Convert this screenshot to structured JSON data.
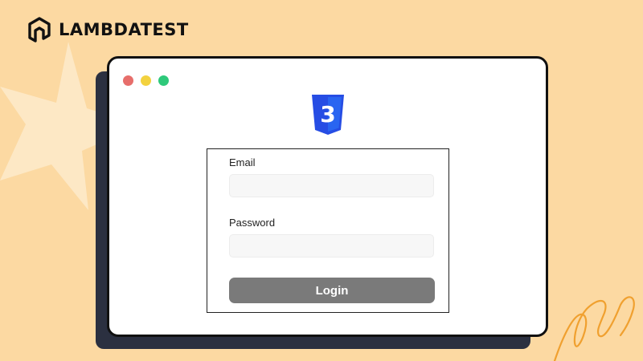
{
  "brand": {
    "name": "LAMBDATEST"
  },
  "window_controls": {
    "close_color": "#e76e6b",
    "minimize_color": "#f3d23f",
    "maximize_color": "#2ec97a"
  },
  "logo": {
    "icon": "css3-logo",
    "text": "3"
  },
  "form": {
    "email_label": "Email",
    "email_value": "",
    "password_label": "Password",
    "password_value": "",
    "login_label": "Login"
  },
  "colors": {
    "background": "#fcd9a2",
    "window_shadow": "#2b3040",
    "css_blue": "#264de4",
    "button": "#7a7a7a"
  }
}
